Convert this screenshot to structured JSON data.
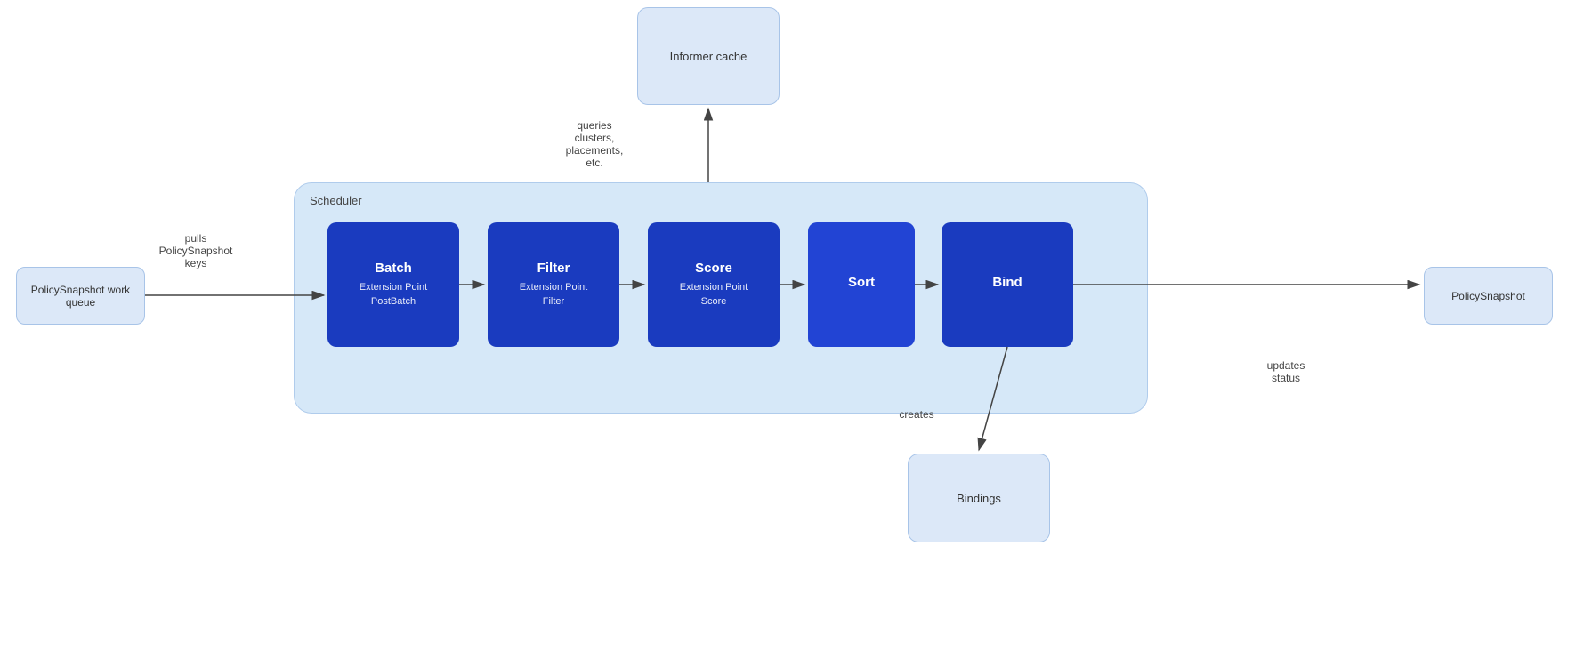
{
  "informer_cache": {
    "label": "Informer cache"
  },
  "scheduler": {
    "label": "Scheduler"
  },
  "policy_work_queue": {
    "label": "PolicySnapshot work queue"
  },
  "policy_snapshot_right": {
    "label": "PolicySnapshot"
  },
  "bindings": {
    "label": "Bindings"
  },
  "boxes": [
    {
      "id": "batch",
      "title": "Batch",
      "subtitle": "Extension Point\nPostBatch"
    },
    {
      "id": "filter",
      "title": "Filter",
      "subtitle": "Extension Point\nFilter"
    },
    {
      "id": "score",
      "title": "Score",
      "subtitle": "Extension Point\nScore"
    },
    {
      "id": "sort",
      "title": "Sort",
      "subtitle": ""
    },
    {
      "id": "bind",
      "title": "Bind",
      "subtitle": ""
    }
  ],
  "arrows": {
    "pulls_label": "pulls\nPolicySnapshot\nkeys",
    "queries_label": "queries\nclusters,\nplacements,\netc.",
    "creates_label": "creates",
    "updates_label": "updates\nstatus"
  }
}
